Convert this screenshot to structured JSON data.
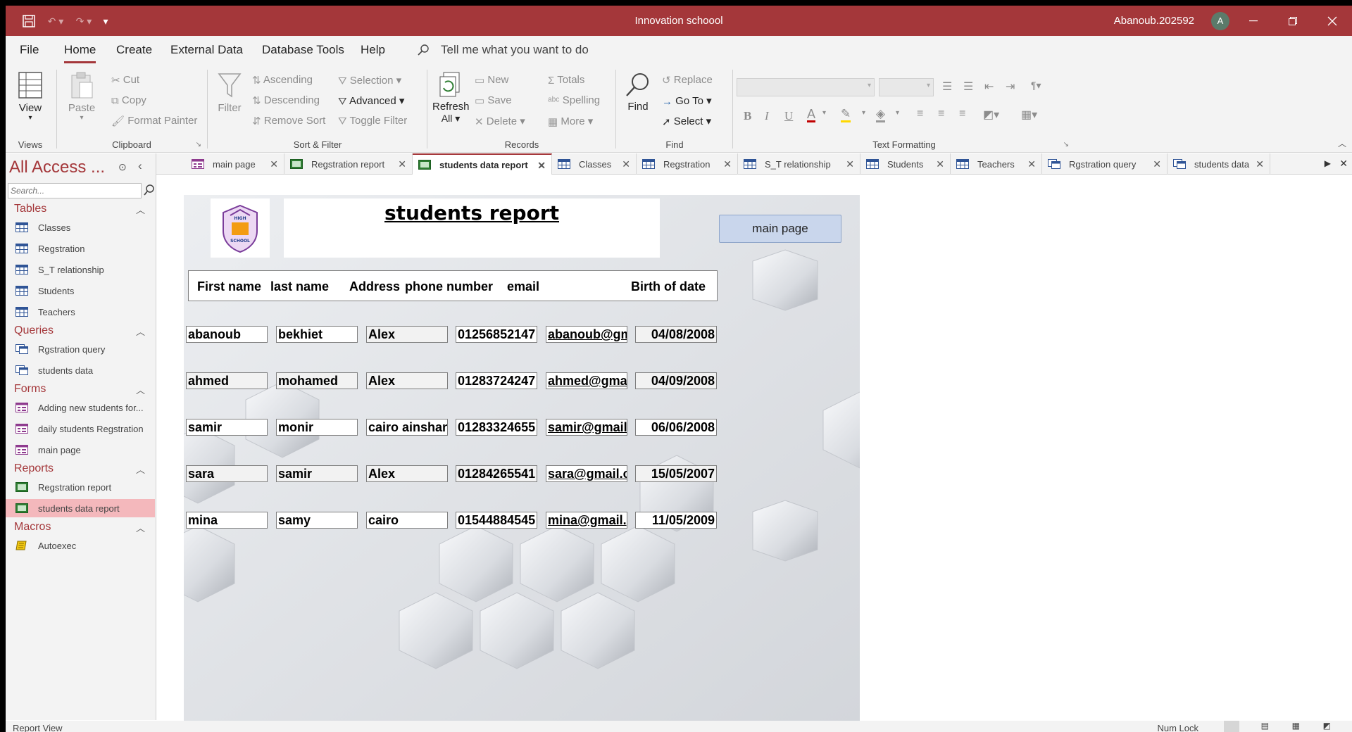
{
  "titlebar": {
    "title": "Innovation schoool",
    "user": "Abanoub.202592",
    "avatar_letter": "A"
  },
  "menu": [
    "File",
    "Home",
    "Create",
    "External Data",
    "Database Tools",
    "Help"
  ],
  "tell_me": "Tell me what you want to do",
  "ribbon": {
    "views": {
      "view_label": "View",
      "group_label": "Views"
    },
    "clipboard": {
      "paste": "Paste",
      "cut": "Cut",
      "copy": "Copy",
      "format_painter": "Format Painter",
      "group_label": "Clipboard"
    },
    "sort_filter": {
      "filter": "Filter",
      "ascending": "Ascending",
      "descending": "Descending",
      "remove_sort": "Remove Sort",
      "selection": "Selection",
      "advanced": "Advanced",
      "toggle_filter": "Toggle Filter",
      "group_label": "Sort & Filter"
    },
    "records": {
      "refresh": "Refresh",
      "refresh_all": "All",
      "new": "New",
      "save": "Save",
      "delete": "Delete",
      "totals": "Totals",
      "spelling": "Spelling",
      "more": "More",
      "group_label": "Records"
    },
    "find": {
      "find": "Find",
      "replace": "Replace",
      "goto": "Go To",
      "select": "Select",
      "group_label": "Find"
    },
    "text_formatting": {
      "group_label": "Text Formatting",
      "bold": "B",
      "italic": "I",
      "underline": "U",
      "font_color": "A"
    }
  },
  "nav": {
    "header": "All Access ...",
    "search_placeholder": "Search...",
    "sections": [
      {
        "title": "Tables",
        "items": [
          "Classes",
          "Regstration",
          "S_T relationship",
          "Students",
          "Teachers"
        ]
      },
      {
        "title": "Queries",
        "items": [
          "Rgstration query",
          "students data"
        ]
      },
      {
        "title": "Forms",
        "items": [
          "Adding new students for...",
          "daily students Regstration",
          "main page"
        ]
      },
      {
        "title": "Reports",
        "items": [
          "Regstration report",
          "students data report"
        ]
      },
      {
        "title": "Macros",
        "items": [
          "Autoexec"
        ]
      }
    ],
    "selected": "students data report"
  },
  "tabs": [
    {
      "label": "main page",
      "kind": "form"
    },
    {
      "label": "Regstration report",
      "kind": "report"
    },
    {
      "label": "students data report",
      "kind": "report",
      "active": true
    },
    {
      "label": "Classes",
      "kind": "table"
    },
    {
      "label": "Regstration",
      "kind": "table"
    },
    {
      "label": "S_T relationship",
      "kind": "table"
    },
    {
      "label": "Students",
      "kind": "table"
    },
    {
      "label": "Teachers",
      "kind": "table"
    },
    {
      "label": "Rgstration query",
      "kind": "query"
    },
    {
      "label": "students data",
      "kind": "query"
    }
  ],
  "report": {
    "title": "students report",
    "logo_lines": [
      "HIGH",
      "SCHOOL"
    ],
    "main_page_button": "main page",
    "columns": [
      "First name",
      "last name",
      "Address",
      "phone number",
      "email",
      "Birth of date"
    ],
    "rows": [
      [
        "abanoub",
        "bekhiet",
        "Alex",
        "01256852147",
        "abanoub@gm",
        "04/08/2008"
      ],
      [
        "ahmed",
        "mohamed",
        "Alex",
        "01283724247",
        "ahmed@gma",
        "04/09/2008"
      ],
      [
        "samir",
        "monir",
        "cairo ainshan",
        "01283324655",
        "samir@gmail",
        "06/06/2008"
      ],
      [
        "sara",
        "samir",
        "Alex",
        "01284265541",
        "sara@gmail.c",
        "15/05/2007"
      ],
      [
        "mina",
        "samy",
        "cairo",
        "01544884545",
        "mina@gmail.",
        "11/05/2009"
      ]
    ]
  },
  "status": {
    "left": "Report View",
    "numlock": "Num Lock"
  },
  "colors": {
    "accent": "#a4373a",
    "selected_nav": "#f4b8bc",
    "button": "#c9d6ec"
  }
}
